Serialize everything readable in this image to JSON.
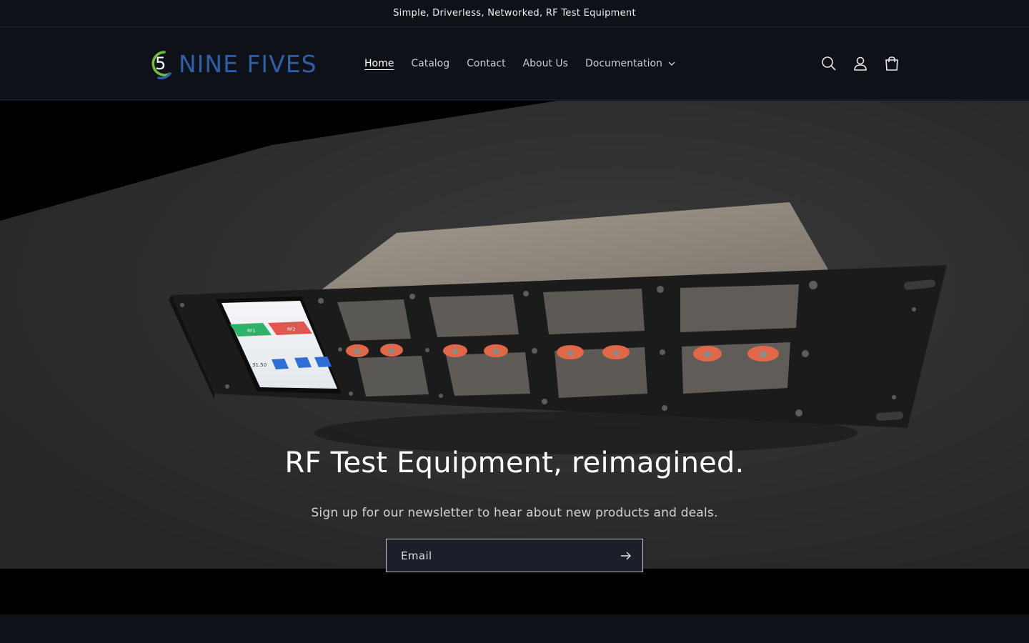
{
  "announcement": {
    "text": "Simple, Driverless, Networked, RF Test Equipment"
  },
  "brand": {
    "name": "NINE FIVES",
    "mark": "5",
    "primary_color": "#2f5fa8",
    "accent_color": "#6fbf3b"
  },
  "nav": {
    "items": [
      {
        "label": "Home",
        "active": true
      },
      {
        "label": "Catalog",
        "active": false
      },
      {
        "label": "Contact",
        "active": false
      },
      {
        "label": "About Us",
        "active": false
      },
      {
        "label": "Documentation",
        "active": false,
        "has_dropdown": true
      }
    ]
  },
  "header_icons": [
    "search-icon",
    "account-icon",
    "cart-icon"
  ],
  "hero": {
    "title": "RF Test Equipment, reimagined.",
    "subtitle": "Sign up for our newsletter to hear about new products and deals.",
    "email_placeholder": "Email",
    "submit_icon": "arrow-right-icon",
    "device_screen": {
      "buttons": [
        "RF1",
        "RF2"
      ],
      "value": "31.50"
    }
  }
}
